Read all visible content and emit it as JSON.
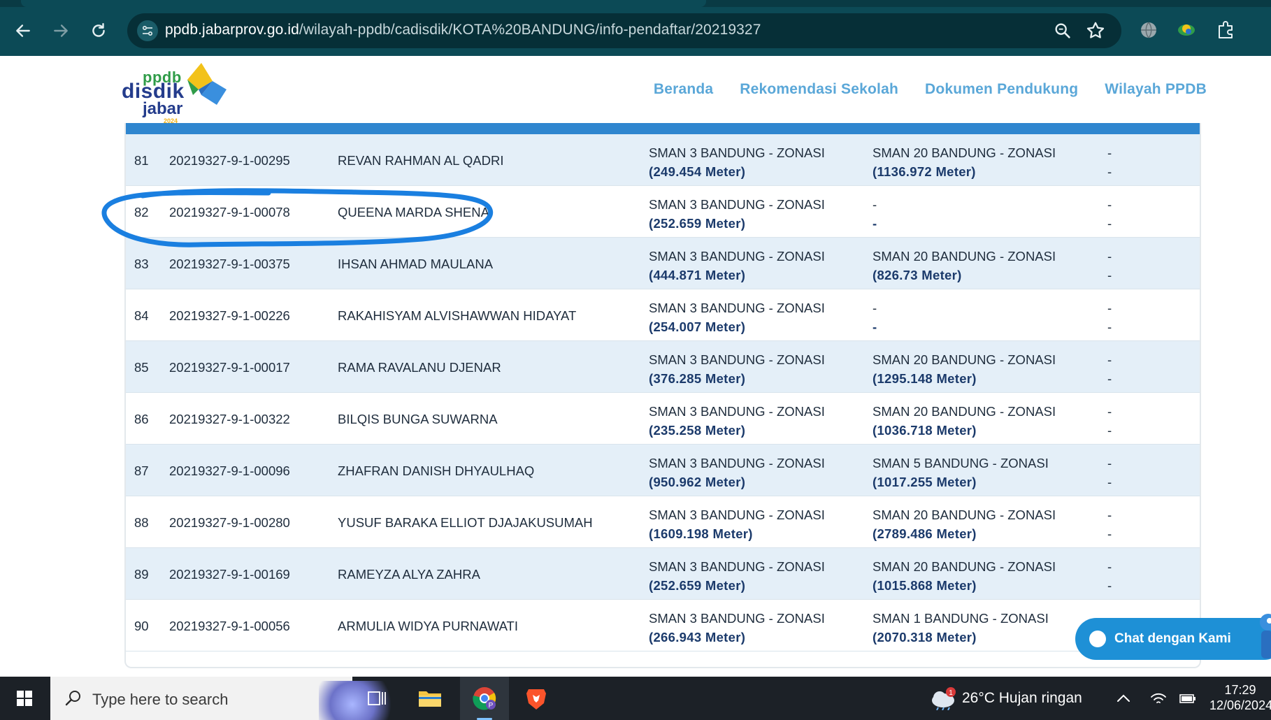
{
  "browser": {
    "url_host": "ppdb.jabarprov.go.id",
    "url_path": "/wilayah-ppdb/cadisdik/KOTA%20BANDUNG/info-pendaftar/20219327"
  },
  "logo": {
    "line1": "ppdb",
    "line2": "disdik",
    "line3": "jabar",
    "year": "2024"
  },
  "nav": {
    "items": [
      "Beranda",
      "Rekomendasi Sekolah",
      "Dokumen Pendukung",
      "Wilayah PPDB"
    ]
  },
  "table": {
    "rows": [
      {
        "no": "81",
        "id": "20219327-9-1-00295",
        "name": "REVAN RAHMAN AL QADRI",
        "p1_school": "SMAN 3 BANDUNG - ZONASI",
        "p1_dist": "(249.454 Meter)",
        "p2_school": "SMAN 20 BANDUNG - ZONASI",
        "p2_dist": "(1136.972 Meter)",
        "p3_a": "-",
        "p3_b": "-"
      },
      {
        "no": "82",
        "id": "20219327-9-1-00078",
        "name": "QUEENA MARDA SHENA",
        "p1_school": "SMAN 3 BANDUNG - ZONASI",
        "p1_dist": "(252.659 Meter)",
        "p2_school": "-",
        "p2_dist": "-",
        "p3_a": "-",
        "p3_b": "-"
      },
      {
        "no": "83",
        "id": "20219327-9-1-00375",
        "name": "IHSAN AHMAD MAULANA",
        "p1_school": "SMAN 3 BANDUNG - ZONASI",
        "p1_dist": "(444.871 Meter)",
        "p2_school": "SMAN 20 BANDUNG - ZONASI",
        "p2_dist": "(826.73 Meter)",
        "p3_a": "-",
        "p3_b": "-"
      },
      {
        "no": "84",
        "id": "20219327-9-1-00226",
        "name": "RAKAHISYAM ALVISHAWWAN HIDAYAT",
        "p1_school": "SMAN 3 BANDUNG - ZONASI",
        "p1_dist": "(254.007 Meter)",
        "p2_school": "-",
        "p2_dist": "-",
        "p3_a": "-",
        "p3_b": "-"
      },
      {
        "no": "85",
        "id": "20219327-9-1-00017",
        "name": "RAMA RAVALANU DJENAR",
        "p1_school": "SMAN 3 BANDUNG - ZONASI",
        "p1_dist": "(376.285 Meter)",
        "p2_school": "SMAN 20 BANDUNG - ZONASI",
        "p2_dist": "(1295.148 Meter)",
        "p3_a": "-",
        "p3_b": "-"
      },
      {
        "no": "86",
        "id": "20219327-9-1-00322",
        "name": "BILQIS BUNGA SUWARNA",
        "p1_school": "SMAN 3 BANDUNG - ZONASI",
        "p1_dist": "(235.258 Meter)",
        "p2_school": "SMAN 20 BANDUNG - ZONASI",
        "p2_dist": "(1036.718 Meter)",
        "p3_a": "-",
        "p3_b": "-"
      },
      {
        "no": "87",
        "id": "20219327-9-1-00096",
        "name": "ZHAFRAN DANISH DHYAULHAQ",
        "p1_school": "SMAN 3 BANDUNG - ZONASI",
        "p1_dist": "(950.962 Meter)",
        "p2_school": "SMAN 5 BANDUNG - ZONASI",
        "p2_dist": "(1017.255 Meter)",
        "p3_a": "-",
        "p3_b": "-"
      },
      {
        "no": "88",
        "id": "20219327-9-1-00280",
        "name": "YUSUF BARAKA ELLIOT DJAJAKUSUMAH",
        "p1_school": "SMAN 3 BANDUNG - ZONASI",
        "p1_dist": "(1609.198 Meter)",
        "p2_school": "SMAN 20 BANDUNG - ZONASI",
        "p2_dist": "(2789.486 Meter)",
        "p3_a": "-",
        "p3_b": "-"
      },
      {
        "no": "89",
        "id": "20219327-9-1-00169",
        "name": "RAMEYZA ALYA ZAHRA",
        "p1_school": "SMAN 3 BANDUNG - ZONASI",
        "p1_dist": "(252.659 Meter)",
        "p2_school": "SMAN 20 BANDUNG - ZONASI",
        "p2_dist": "(1015.868 Meter)",
        "p3_a": "-",
        "p3_b": "-"
      },
      {
        "no": "90",
        "id": "20219327-9-1-00056",
        "name": "ARMULIA WIDYA PURNAWATI",
        "p1_school": "SMAN 3 BANDUNG - ZONASI",
        "p1_dist": "(266.943 Meter)",
        "p2_school": "SMAN 1 BANDUNG - ZONASI",
        "p2_dist": "(2070.318 Meter)",
        "p3_a": "-",
        "p3_b": ""
      }
    ]
  },
  "chat": {
    "label": "Chat dengan Kami"
  },
  "taskbar": {
    "search_placeholder": "Type here to search",
    "weather": "26°C  Hujan ringan",
    "weather_badge": "1",
    "time": "17:29",
    "date": "12/06/2024"
  },
  "colors": {
    "browser_chrome": "#0c4a56",
    "nav_link": "#5aa7d8",
    "table_header_bar": "#2f86cf",
    "row_alt": "#e4eff8",
    "highlight_stroke": "#1a7fe0",
    "chat_button": "#1e90d6"
  }
}
